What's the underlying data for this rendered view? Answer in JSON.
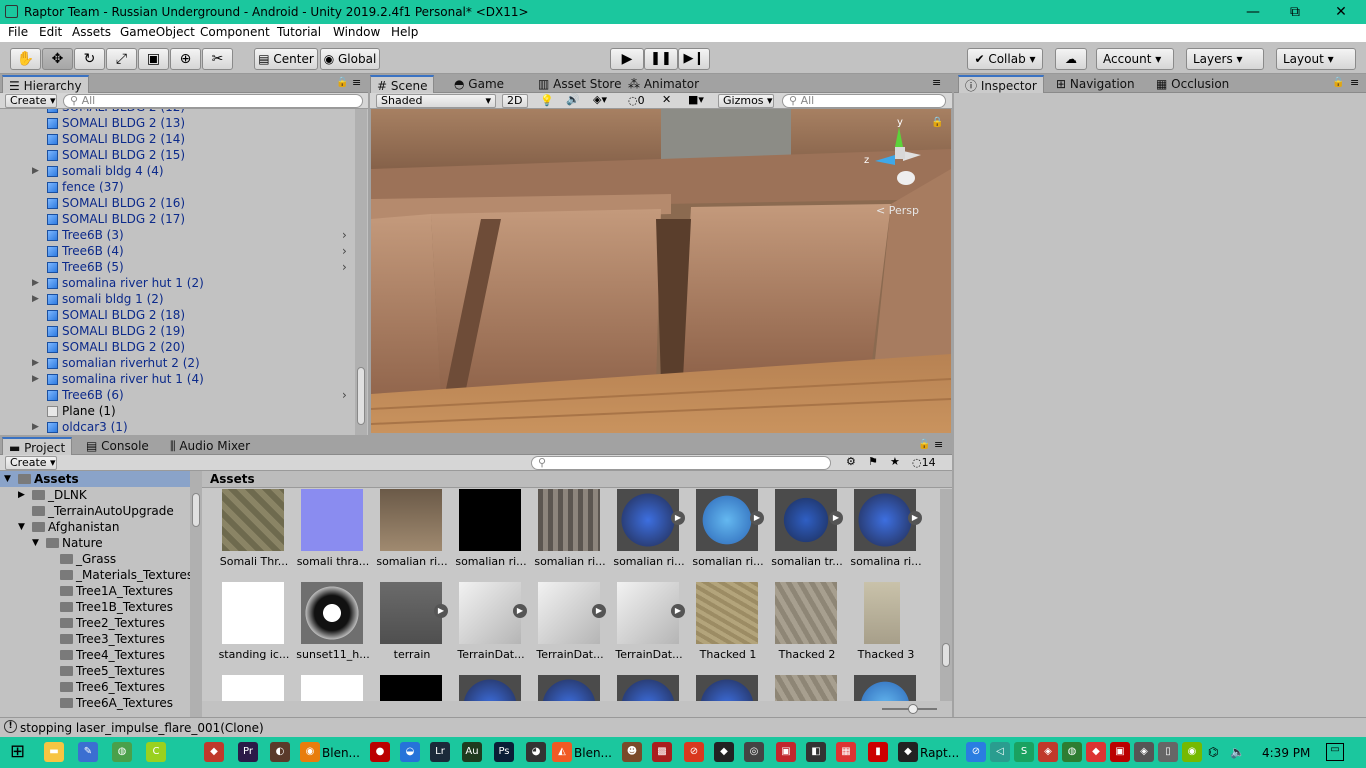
{
  "window": {
    "title": "Raptor Team - Russian Underground - Android - Unity 2019.2.4f1 Personal* <DX11>",
    "min": "—",
    "restore": "⧉",
    "close": "✕"
  },
  "menu": [
    "File",
    "Edit",
    "Assets",
    "GameObject",
    "Component",
    "Tutorial",
    "Window",
    "Help"
  ],
  "toolbar": {
    "pivot": "Center",
    "space": "Global",
    "collab": "Collab",
    "account": "Account",
    "layers": "Layers",
    "layout": "Layout"
  },
  "hierarchy": {
    "tab": "Hierarchy",
    "create": "Create",
    "search_placeholder": "All",
    "rows": [
      {
        "label": "SOMALI BLDG 2 (12)",
        "arrow": "",
        "chev": ""
      },
      {
        "label": "SOMALI BLDG 2 (13)",
        "arrow": "",
        "chev": ""
      },
      {
        "label": "SOMALI BLDG 2 (14)",
        "arrow": "",
        "chev": ""
      },
      {
        "label": "SOMALI BLDG 2 (15)",
        "arrow": "",
        "chev": ""
      },
      {
        "label": "somali bldg 4 (4)",
        "arrow": "▶",
        "chev": ""
      },
      {
        "label": "fence (37)",
        "arrow": "",
        "chev": ""
      },
      {
        "label": "SOMALI BLDG 2 (16)",
        "arrow": "",
        "chev": ""
      },
      {
        "label": "SOMALI BLDG 2 (17)",
        "arrow": "",
        "chev": ""
      },
      {
        "label": "Tree6B (3)",
        "arrow": "",
        "chev": "›"
      },
      {
        "label": "Tree6B (4)",
        "arrow": "",
        "chev": "›"
      },
      {
        "label": "Tree6B (5)",
        "arrow": "",
        "chev": "›"
      },
      {
        "label": "somalina river hut 1 (2)",
        "arrow": "▶",
        "chev": ""
      },
      {
        "label": "somali bldg 1 (2)",
        "arrow": "▶",
        "chev": ""
      },
      {
        "label": "SOMALI BLDG 2 (18)",
        "arrow": "",
        "chev": ""
      },
      {
        "label": "SOMALI BLDG 2 (19)",
        "arrow": "",
        "chev": ""
      },
      {
        "label": "SOMALI BLDG 2 (20)",
        "arrow": "",
        "chev": ""
      },
      {
        "label": "somalian riverhut 2 (2)",
        "arrow": "▶",
        "chev": ""
      },
      {
        "label": "somalina river hut 1 (4)",
        "arrow": "▶",
        "chev": ""
      },
      {
        "label": "Tree6B (6)",
        "arrow": "",
        "chev": "›"
      },
      {
        "label": "Plane (1)",
        "arrow": "",
        "chev": ""
      },
      {
        "label": "oldcar3 (1)",
        "arrow": "▶",
        "chev": ""
      }
    ]
  },
  "scene": {
    "tabs": [
      "Scene",
      "Game",
      "Asset Store",
      "Animator"
    ],
    "shading": "Shaded",
    "mode2d": "2D",
    "fx_count": "0",
    "gizmos": "Gizmos",
    "search_placeholder": "All",
    "persp": "< Persp",
    "axis_y": "y",
    "axis_z": "z"
  },
  "inspector": {
    "tabs": [
      "Inspector",
      "Navigation",
      "Occlusion"
    ]
  },
  "project": {
    "tabs": [
      "Project",
      "Console",
      "Audio Mixer"
    ],
    "create": "Create",
    "hidden_count": "14",
    "tree": [
      {
        "label": "Assets",
        "depth": 0,
        "arrow": "▼",
        "bold": true
      },
      {
        "label": "_DLNK",
        "depth": 1,
        "arrow": "▶"
      },
      {
        "label": "_TerrainAutoUpgrade",
        "depth": 1,
        "arrow": ""
      },
      {
        "label": "Afghanistan",
        "depth": 1,
        "arrow": "▼"
      },
      {
        "label": "Nature",
        "depth": 2,
        "arrow": "▼"
      },
      {
        "label": "_Grass",
        "depth": 3,
        "arrow": ""
      },
      {
        "label": "_Materials_Textures",
        "depth": 3,
        "arrow": ""
      },
      {
        "label": "Tree1A_Textures",
        "depth": 3,
        "arrow": ""
      },
      {
        "label": "Tree1B_Textures",
        "depth": 3,
        "arrow": ""
      },
      {
        "label": "Tree2_Textures",
        "depth": 3,
        "arrow": ""
      },
      {
        "label": "Tree3_Textures",
        "depth": 3,
        "arrow": ""
      },
      {
        "label": "Tree4_Textures",
        "depth": 3,
        "arrow": ""
      },
      {
        "label": "Tree5_Textures",
        "depth": 3,
        "arrow": ""
      },
      {
        "label": "Tree6_Textures",
        "depth": 3,
        "arrow": ""
      },
      {
        "label": "Tree6A_Textures",
        "depth": 3,
        "arrow": ""
      }
    ],
    "breadcrumb": "Assets",
    "assets": [
      {
        "label": "Somali Thr...",
        "kind": "camo",
        "play": false
      },
      {
        "label": "somali thra...",
        "kind": "normal",
        "play": false
      },
      {
        "label": "somalian ri...",
        "kind": "hut",
        "play": false
      },
      {
        "label": "somalian ri...",
        "kind": "dark",
        "play": false
      },
      {
        "label": "somalian ri...",
        "kind": "wood",
        "play": false
      },
      {
        "label": "somalian ri...",
        "kind": "bluemodel",
        "play": true
      },
      {
        "label": "somalian ri...",
        "kind": "blueflat",
        "play": true
      },
      {
        "label": "somalian tr...",
        "kind": "bluetruck",
        "play": true
      },
      {
        "label": "somalina ri...",
        "kind": "bluemodel",
        "play": true
      },
      {
        "label": "standing ic...",
        "kind": "white",
        "play": false
      },
      {
        "label": "sunset11_h...",
        "kind": "sphere",
        "play": false
      },
      {
        "label": "terrain",
        "kind": "terrain",
        "play": true
      },
      {
        "label": "TerrainDat...",
        "kind": "tdata",
        "play": true
      },
      {
        "label": "TerrainDat...",
        "kind": "tdata",
        "play": true
      },
      {
        "label": "TerrainDat...",
        "kind": "tdata",
        "play": true
      },
      {
        "label": "Thacked 1",
        "kind": "grass",
        "play": false
      },
      {
        "label": "Thacked 2",
        "kind": "rock",
        "play": false
      },
      {
        "label": "Thacked 3",
        "kind": "tall",
        "play": false
      }
    ]
  },
  "status": {
    "message": "stopping laser_impulse_flare_001(Clone)"
  },
  "taskbar": {
    "items": [
      {
        "label": "Blen...",
        "color": "#e87d0d"
      },
      {
        "label": "Blen...",
        "color": "#f15a24"
      },
      {
        "label": "Rapt...",
        "color": "#222222"
      }
    ],
    "time": "4:39 PM"
  }
}
